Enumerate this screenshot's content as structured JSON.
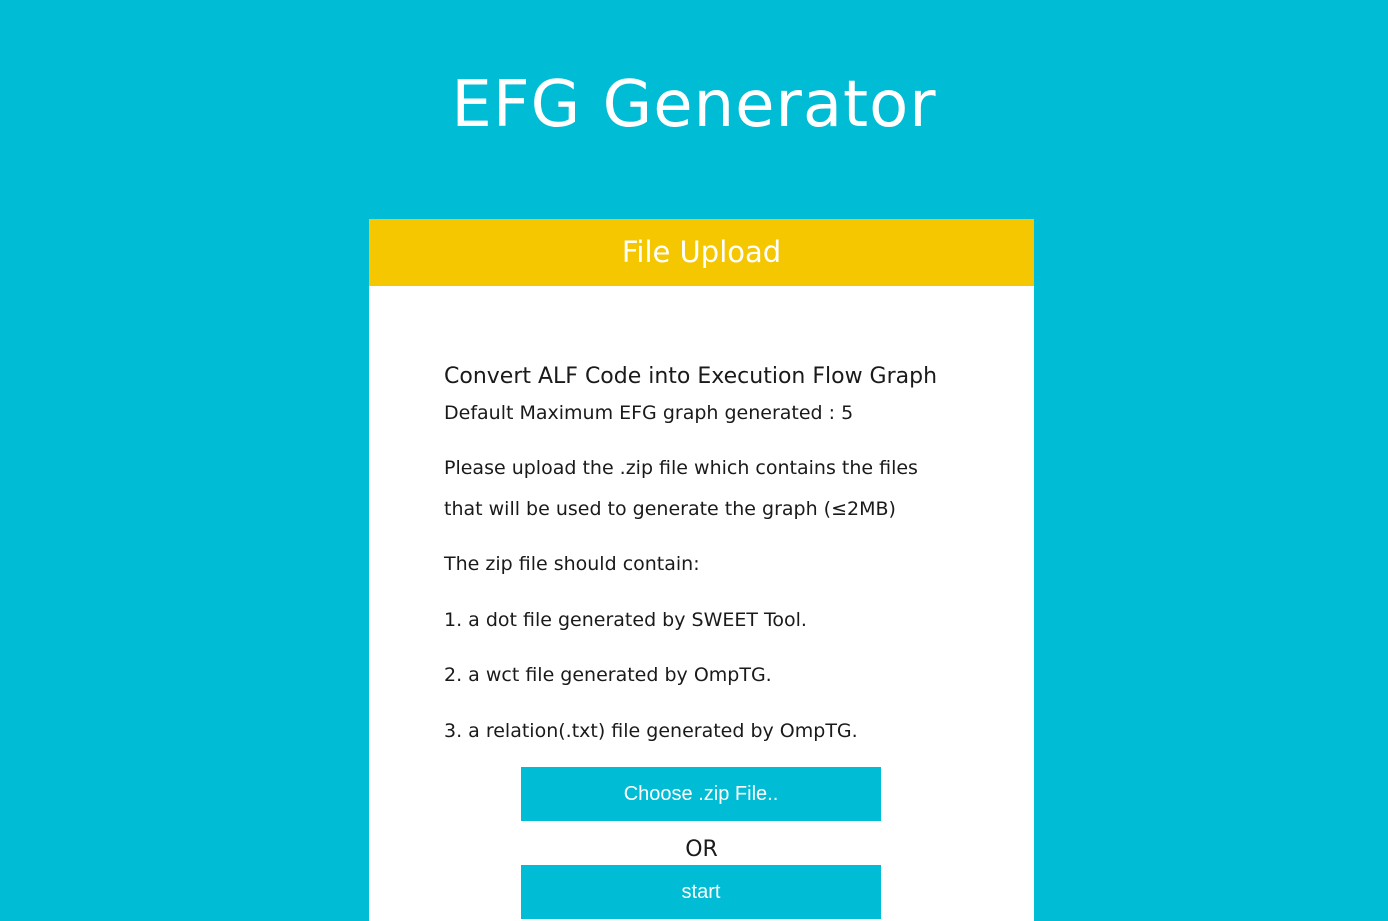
{
  "app": {
    "title": "EFG Generator"
  },
  "card": {
    "header": "File Upload",
    "heading": "Convert ALF Code into Execution Flow Graph",
    "default_max": "Default Maximum EFG graph generated : 5",
    "upload_line1": "Please upload the .zip file which contains the files",
    "upload_line2": "that will be used to generate the graph (≤2MB)",
    "contain_intro": "The zip file should contain:",
    "items": [
      "1. a dot file generated by SWEET Tool.",
      "2. a wct file generated by OmpTG.",
      "3. a relation(.txt) file generated by OmpTG."
    ],
    "choose_button": "Choose .zip File..",
    "or_label": "OR",
    "start_button": "start"
  },
  "colors": {
    "background": "#00BCD4",
    "header": "#F4C700",
    "button": "#00BCD4"
  }
}
